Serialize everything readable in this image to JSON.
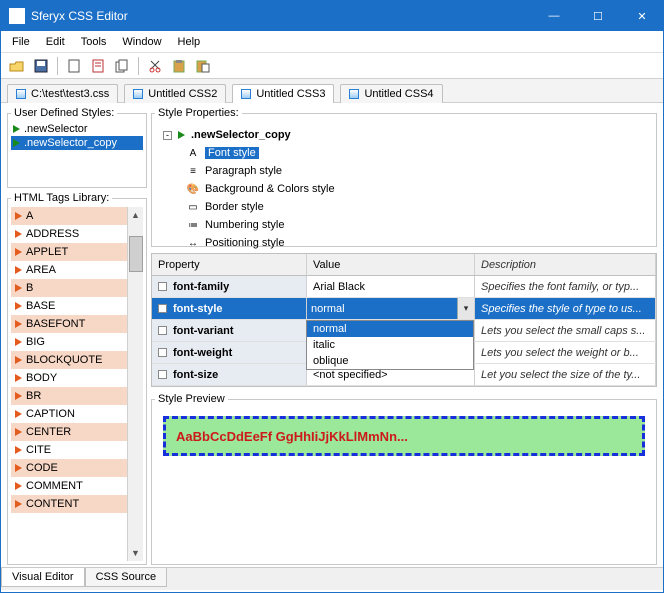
{
  "window": {
    "title": "Sferyx CSS Editor"
  },
  "menu": {
    "file": "File",
    "edit": "Edit",
    "tools": "Tools",
    "window": "Window",
    "help": "Help"
  },
  "tabs": [
    {
      "label": "C:\\test\\test3.css"
    },
    {
      "label": "Untitled CSS2"
    },
    {
      "label": "Untitled CSS3"
    },
    {
      "label": "Untitled CSS4"
    }
  ],
  "uds": {
    "legend": "User Defined Styles:",
    "items": [
      ".newSelector",
      ".newSelector_copy"
    ]
  },
  "taglib": {
    "legend": "HTML Tags Library:",
    "items": [
      "A",
      "ADDRESS",
      "APPLET",
      "AREA",
      "B",
      "BASE",
      "BASEFONT",
      "BIG",
      "BLOCKQUOTE",
      "BODY",
      "BR",
      "CAPTION",
      "CENTER",
      "CITE",
      "CODE",
      "COMMENT",
      "CONTENT"
    ]
  },
  "styleprops": {
    "legend": "Style Properties:",
    "root": ".newSelector_copy",
    "items": [
      "Font style",
      "Paragraph style",
      "Background & Colors style",
      "Border style",
      "Numbering style",
      "Positioning style"
    ]
  },
  "grid": {
    "headers": {
      "prop": "Property",
      "val": "Value",
      "desc": "Description"
    },
    "rows": [
      {
        "prop": "font-family",
        "val": "Arial Black",
        "desc": "Specifies the font family, or typ..."
      },
      {
        "prop": "font-style",
        "val": "normal",
        "desc": "Specifies the style of type to us..."
      },
      {
        "prop": "font-variant",
        "val": "",
        "desc": "Lets you select the small caps s..."
      },
      {
        "prop": "font-weight",
        "val": "",
        "desc": "Lets you select the weight or b..."
      },
      {
        "prop": "font-size",
        "val": "<not specified>",
        "desc": "Let you select the size of the ty..."
      }
    ],
    "dropdown": [
      "normal",
      "italic",
      "oblique"
    ]
  },
  "preview": {
    "legend": "Style Preview",
    "text": "AaBbCcDdEeFf GgHhIiJjKkLlMmNn..."
  },
  "bottomtabs": {
    "visual": "Visual Editor",
    "source": "CSS Source"
  }
}
